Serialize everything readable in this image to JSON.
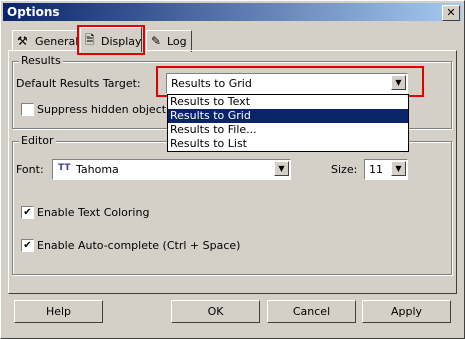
{
  "window": {
    "title": "Options",
    "close_glyph": "✕"
  },
  "tabs": [
    {
      "label": "General",
      "icon": "tools-icon"
    },
    {
      "label": "Display",
      "icon": "display-icon"
    },
    {
      "label": "Log",
      "icon": "log-icon"
    }
  ],
  "results": {
    "group_label": "Results",
    "target_label": "Default Results Target:",
    "target_value": "Results to Grid",
    "options": [
      "Results to Text",
      "Results to Grid",
      "Results to File...",
      "Results to List"
    ],
    "selected_option": "Results to Grid",
    "suppress_label": "Suppress hidden object(s) in"
  },
  "editor": {
    "group_label": "Editor",
    "font_label": "Font:",
    "font_value": "Tahoma",
    "size_label": "Size:",
    "size_value": "11",
    "text_coloring_label": "Enable Text Coloring",
    "autocomplete_label": "Enable Auto-complete (Ctrl + Space)",
    "text_coloring_checked": true,
    "autocomplete_checked": true
  },
  "buttons": {
    "help": "Help",
    "ok": "OK",
    "cancel": "Cancel",
    "apply": "Apply"
  },
  "colors": {
    "highlight": "#e00000",
    "selection": "#0a246a"
  }
}
